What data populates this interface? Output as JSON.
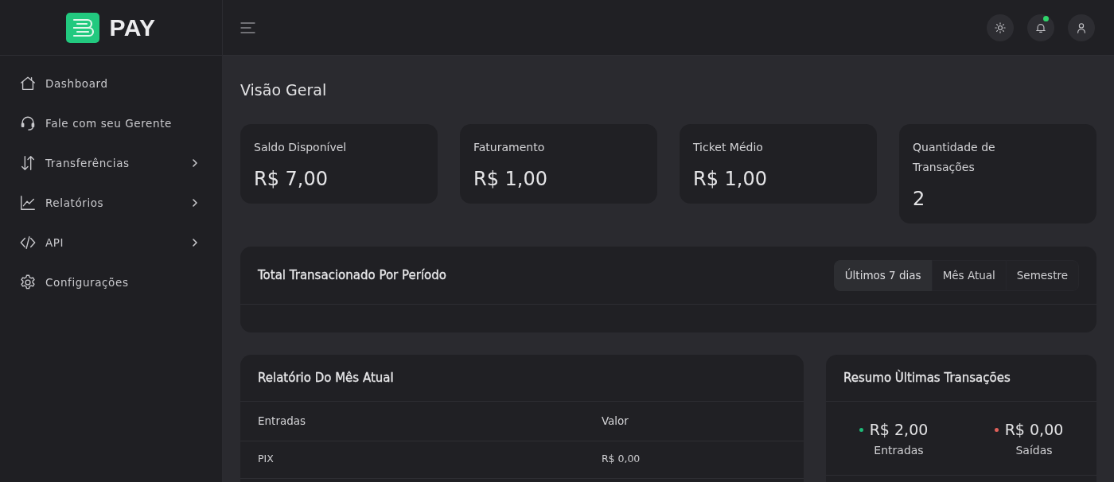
{
  "brand": {
    "name": "PAY"
  },
  "sidebar": {
    "items": [
      {
        "label": "Dashboard",
        "submenu": false
      },
      {
        "label": "Fale com seu Gerente",
        "submenu": false
      },
      {
        "label": "Transferências",
        "submenu": true
      },
      {
        "label": "Relatórios",
        "submenu": true
      },
      {
        "label": "API",
        "submenu": true
      },
      {
        "label": "Configurações",
        "submenu": false
      }
    ]
  },
  "header": {
    "notification_dot": true
  },
  "page_title": "Visão Geral",
  "stats": [
    {
      "label": "Saldo Disponível",
      "value": "R$ 7,00"
    },
    {
      "label": "Faturamento",
      "value": "R$ 1,00"
    },
    {
      "label": "Ticket Médio",
      "value": "R$ 1,00"
    },
    {
      "label": "Quantidade de Transações",
      "value": "2"
    }
  ],
  "period_panel": {
    "title": "Total Transacionado Por Período",
    "periods": [
      {
        "label": "Últimos 7 dias",
        "selected": true
      },
      {
        "label": "Mês Atual",
        "selected": false
      },
      {
        "label": "Semestre",
        "selected": false
      }
    ]
  },
  "report": {
    "title": "Relatório Do Mês Atual",
    "columns": [
      "Entradas",
      "Valor"
    ],
    "rows": [
      [
        "PIX",
        "R$ 0,00"
      ]
    ]
  },
  "summary": {
    "title": "Resumo Ùltimas Transações",
    "items": [
      {
        "value": "R$ 2,00",
        "label": "Entradas",
        "color": "#1fb978"
      },
      {
        "value": "R$ 0,00",
        "label": "Saídas",
        "color": "#e0605a"
      }
    ]
  }
}
